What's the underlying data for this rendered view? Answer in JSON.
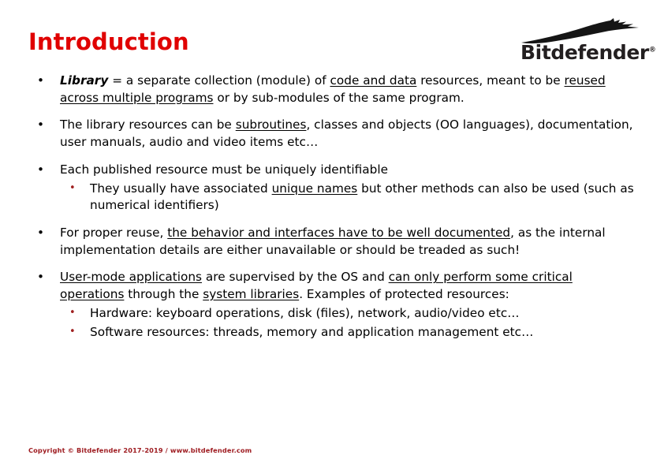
{
  "slide": {
    "title": "Introduction",
    "title_color": "#e00000",
    "background_color": "#ffffff"
  },
  "logo": {
    "name": "bitdefender-logo",
    "wordmark": "Bitdefender",
    "trademark_symbol": "®",
    "color": "#231f20"
  },
  "bullets": [
    {
      "level": 1,
      "marker": "•",
      "marker_color": "#000000",
      "segments": [
        {
          "text": "Library",
          "style": "bold-italic"
        },
        {
          "text": " = a separate collection (module) of ",
          "style": "normal"
        },
        {
          "text": "code and data",
          "style": "underline"
        },
        {
          "text": " resources, meant to be ",
          "style": "normal"
        },
        {
          "text": "reused across multiple programs",
          "style": "underline"
        },
        {
          "text": " or by sub-modules of the same program.",
          "style": "normal"
        }
      ]
    },
    {
      "level": 1,
      "marker": "•",
      "marker_color": "#000000",
      "segments": [
        {
          "text": "The library resources can be ",
          "style": "normal"
        },
        {
          "text": "subroutines",
          "style": "underline"
        },
        {
          "text": ", classes and objects (OO languages), documentation, user manuals, audio and video items etc…",
          "style": "normal"
        }
      ]
    },
    {
      "level": 1,
      "marker": "•",
      "marker_color": "#000000",
      "segments": [
        {
          "text": "Each published resource must be uniquely identifiable",
          "style": "normal"
        }
      ]
    },
    {
      "level": 2,
      "marker": "•",
      "marker_color": "#a02020",
      "segments": [
        {
          "text": "They usually have associated ",
          "style": "normal"
        },
        {
          "text": "unique names",
          "style": "underline"
        },
        {
          "text": " but other methods can also be used (such as numerical identifiers)",
          "style": "normal"
        }
      ]
    },
    {
      "level": 1,
      "marker": "•",
      "marker_color": "#000000",
      "segments": [
        {
          "text": "For proper reuse, ",
          "style": "normal"
        },
        {
          "text": "the behavior and interfaces have to be well documented",
          "style": "underline"
        },
        {
          "text": ", as the internal implementation details are either unavailable or should be treaded as such!",
          "style": "normal"
        }
      ]
    },
    {
      "level": 1,
      "marker": "•",
      "marker_color": "#000000",
      "segments": [
        {
          "text": "User-mode applications",
          "style": "underline"
        },
        {
          "text": " are supervised by the OS and ",
          "style": "normal"
        },
        {
          "text": "can only perform some critical operations",
          "style": "underline"
        },
        {
          "text": " through the ",
          "style": "normal"
        },
        {
          "text": "system libraries",
          "style": "underline"
        },
        {
          "text": ". Examples of protected resources:",
          "style": "normal"
        }
      ]
    },
    {
      "level": 2,
      "marker": "•",
      "marker_color": "#a02020",
      "segments": [
        {
          "text": "Hardware: keyboard operations, disk (files), network, audio/video etc…",
          "style": "normal"
        }
      ]
    },
    {
      "level": 2,
      "marker": "•",
      "marker_color": "#a02020",
      "segments": [
        {
          "text": "Software resources: threads, memory and application management etc…",
          "style": "normal"
        }
      ]
    }
  ],
  "footer": {
    "text": "Copyright © Bitdefender 2017-2019 / www.bitdefender.com",
    "color": "#9e1b20"
  }
}
